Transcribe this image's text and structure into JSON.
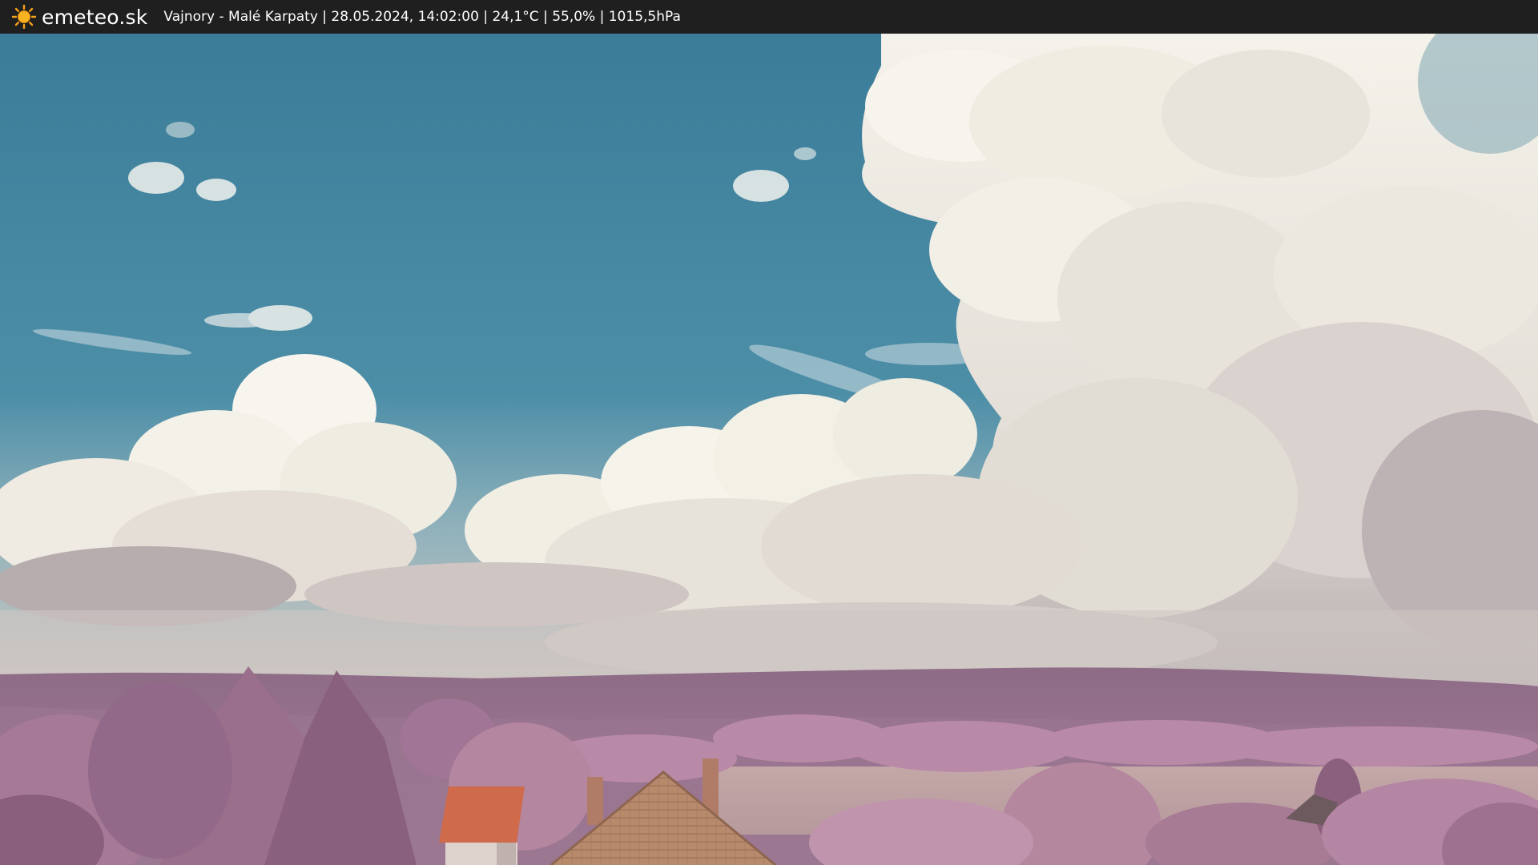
{
  "header": {
    "brand": "emeteo.sk",
    "info": "Vajnory - Malé Karpaty | 28.05.2024, 14:02:00 | 24,1°C | 55,0% | 1015,5hPa",
    "logo_icon": "sun-icon"
  },
  "colors": {
    "bar": "#1f1f1f",
    "sky_top": "#3a7f9c",
    "sky_low": "#5d99ad",
    "cloud": "#f1efe3",
    "cloud_shade": "#c9c2bd",
    "foliage": "#9c6f8d",
    "foliage_dark": "#6f4a63",
    "hills": "#8a6a85",
    "roof": "#c97a56",
    "field": "#c3a6a6"
  }
}
